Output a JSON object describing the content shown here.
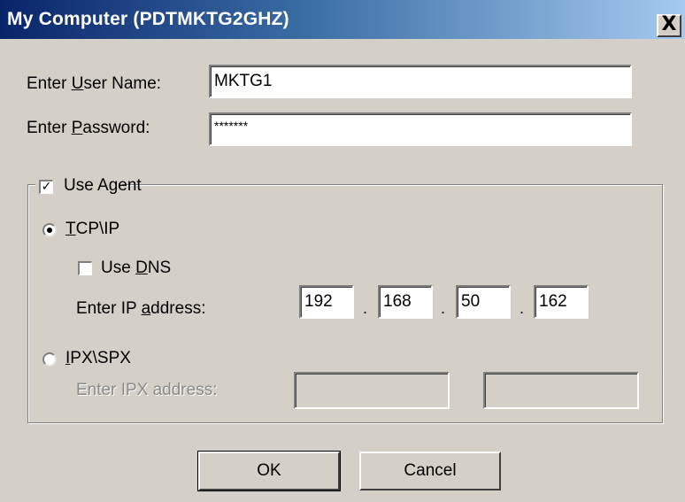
{
  "window": {
    "title": "My Computer (PDTMKTG2GHZ)",
    "close_glyph": "X"
  },
  "user_name": {
    "label_pre": "Enter ",
    "label_key": "U",
    "label_post": "ser Name:",
    "value": "MKTG1"
  },
  "password": {
    "label_pre": "Enter ",
    "label_key": "P",
    "label_post": "assword:",
    "value": "*******"
  },
  "agent": {
    "label": "Use Agent",
    "checked": true
  },
  "tcpip": {
    "label_key": "T",
    "label_post": "CP\\IP",
    "selected": true,
    "dns": {
      "label_pre": "Use ",
      "label_key": "D",
      "label_post": "NS",
      "checked": false
    },
    "ip_label_pre": "Enter IP ",
    "ip_label_key": "a",
    "ip_label_post": "ddress:",
    "ip_octets": [
      "192",
      "168",
      "50",
      "162"
    ],
    "separator": "."
  },
  "ipxspx": {
    "label_key": "I",
    "label_post": "PX\\SPX",
    "selected": false,
    "address_label": "Enter IPX address:",
    "address_values": [
      "",
      ""
    ]
  },
  "buttons": {
    "ok": "OK",
    "cancel": "Cancel"
  }
}
